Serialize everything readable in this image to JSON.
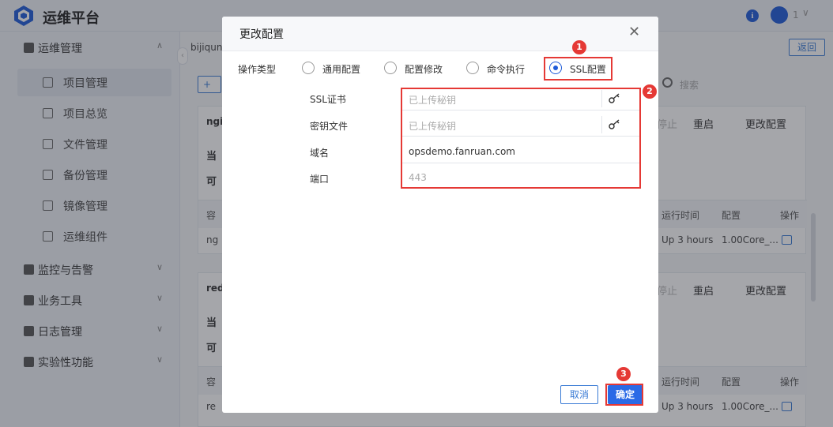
{
  "app": {
    "title": "运维平台",
    "user_count": "1"
  },
  "sidebar": {
    "group_ops": "运维管理",
    "items": [
      {
        "label": "项目管理",
        "active": true
      },
      {
        "label": "项目总览"
      },
      {
        "label": "文件管理"
      },
      {
        "label": "备份管理"
      },
      {
        "label": "镜像管理"
      },
      {
        "label": "运维组件"
      }
    ],
    "groups": [
      {
        "label": "监控与告警"
      },
      {
        "label": "业务工具"
      },
      {
        "label": "日志管理"
      },
      {
        "label": "实验性功能"
      }
    ]
  },
  "main": {
    "breadcrumb": "bijiqun",
    "back_label": "返回",
    "add_label": "+",
    "search_placeholder": "搜索",
    "cards": [
      {
        "name": "ngi",
        "action_stop": "停止",
        "action_restart": "重启",
        "action_config": "更改配置",
        "row1": "当",
        "row2": "可",
        "head_container": "容",
        "head_runtime": "运行时间",
        "head_config": "配置",
        "head_ops": "操作",
        "cell_name": "ng",
        "cell_runtime": "Up 3 hours",
        "cell_config": "1.00Core_..."
      },
      {
        "name": "redi",
        "action_stop": "停止",
        "action_restart": "重启",
        "action_config": "更改配置",
        "row1": "当",
        "row2": "可",
        "head_container": "容",
        "head_runtime": "运行时间",
        "head_config": "配置",
        "head_ops": "操作",
        "cell_name": "re",
        "cell_runtime": "Up 3 hours",
        "cell_config": "1.00Core_..."
      }
    ]
  },
  "modal": {
    "title": "更改配置",
    "op_type_label": "操作类型",
    "options": [
      {
        "label": "通用配置",
        "checked": false
      },
      {
        "label": "配置修改",
        "checked": false
      },
      {
        "label": "命令执行",
        "checked": false
      },
      {
        "label": "SSL配置",
        "checked": true
      }
    ],
    "fields": [
      {
        "label": "SSL证书",
        "value": "已上传秘钥",
        "is_placeholder": true
      },
      {
        "label": "密钥文件",
        "value": "已上传秘钥",
        "is_placeholder": true
      },
      {
        "label": "域名",
        "value": "opsdemo.fanruan.com",
        "is_placeholder": false
      },
      {
        "label": "端口",
        "value": "443",
        "is_placeholder": true
      }
    ],
    "cancel_label": "取消",
    "ok_label": "确定"
  },
  "annotations": {
    "badge1": "1",
    "badge2": "2",
    "badge3": "3"
  },
  "colors": {
    "accent": "#2a6ae6",
    "annotation_red": "#e53935"
  }
}
